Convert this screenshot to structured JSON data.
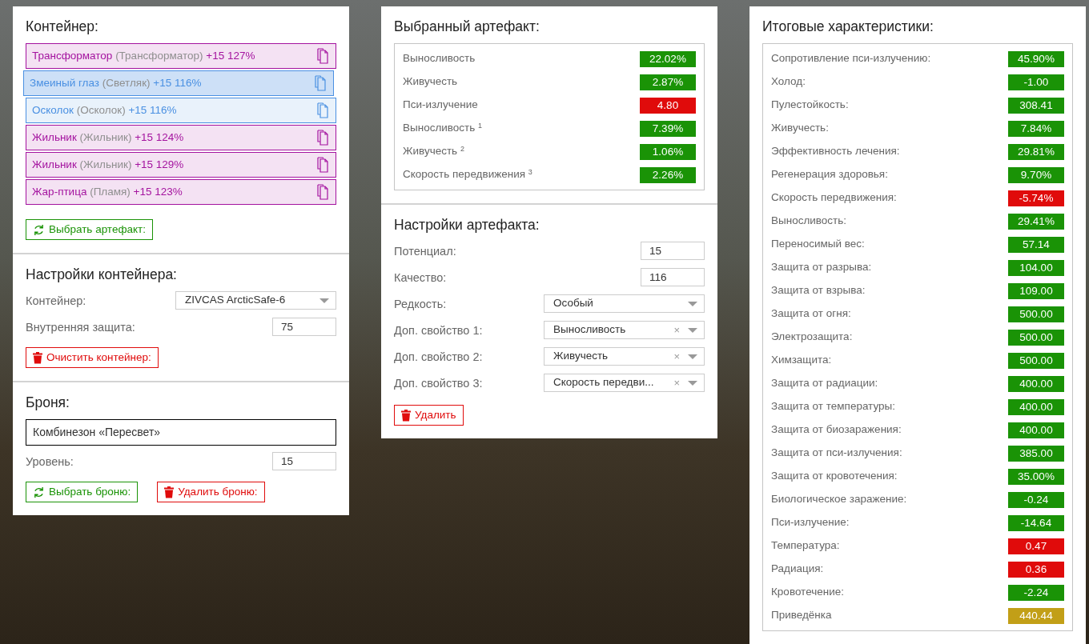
{
  "container": {
    "title": "Контейнер:",
    "artifacts": [
      {
        "name": "Трансформатор",
        "origin": "(Трансформатор)",
        "bonus": "+15 127%",
        "color": "#a4139f",
        "selected": false
      },
      {
        "name": "Змеиный глаз",
        "origin": "(Светляк)",
        "bonus": "+15 116%",
        "color": "#4a90e2",
        "selected": true
      },
      {
        "name": "Осколок",
        "origin": "(Осколок)",
        "bonus": "+15 116%",
        "color": "#4a90e2",
        "selected": false
      },
      {
        "name": "Жильник",
        "origin": "(Жильник)",
        "bonus": "+15 124%",
        "color": "#a4139f",
        "selected": false
      },
      {
        "name": "Жильник",
        "origin": "(Жильник)",
        "bonus": "+15 129%",
        "color": "#a4139f",
        "selected": false
      },
      {
        "name": "Жар-птица",
        "origin": "(Пламя)",
        "bonus": "+15 123%",
        "color": "#a4139f",
        "selected": false
      }
    ],
    "buttons": [
      {
        "kind": "select",
        "label": "Выбрать артефакт:"
      }
    ]
  },
  "container_settings": {
    "title": "Настройки контейнера:",
    "fields": [
      {
        "kind": "select",
        "label": "Контейнер:",
        "value": "ZIVCAS ArcticSafe-6"
      },
      {
        "kind": "input",
        "label": "Внутренняя защита:",
        "value": "75"
      }
    ],
    "buttons": [
      {
        "kind": "delete",
        "label": "Очистить контейнер:"
      }
    ]
  },
  "armor": {
    "title": "Броня:",
    "name": "Комбинезон «Пересвет»",
    "fields": [
      {
        "kind": "input",
        "label": "Уровень:",
        "value": "15"
      }
    ],
    "buttons": [
      {
        "kind": "select",
        "label": "Выбрать броню:"
      },
      {
        "kind": "delete",
        "label": "Удалить броню:"
      }
    ]
  },
  "selected_artifact": {
    "title": "Выбранный артефакт:",
    "stats": [
      {
        "name": "Выносливость",
        "value": "22.02%",
        "color": "#1a9306"
      },
      {
        "name": "Живучесть",
        "value": "2.87%",
        "color": "#1a9306"
      },
      {
        "name": "Пси-излучение",
        "value": "4.80",
        "color": "#e00b0b"
      },
      {
        "name": "Выносливость $^{1}$",
        "value": "7.39%",
        "color": "#1a9306"
      },
      {
        "name": "Живучесть $^{2}$",
        "value": "1.06%",
        "color": "#1a9306"
      },
      {
        "name": "Скорость передвижения $^{3}$",
        "value": "2.26%",
        "color": "#1a9306"
      }
    ]
  },
  "artifact_settings": {
    "title": "Настройки артефакта:",
    "fields": [
      {
        "kind": "input",
        "label": "Потенциал:",
        "value": "15"
      },
      {
        "kind": "input",
        "label": "Качество:",
        "value": "116"
      },
      {
        "kind": "select",
        "label": "Редкость:",
        "value": "Особый"
      },
      {
        "kind": "select",
        "label": "Доп. свойство 1:",
        "value": "Выносливость",
        "clear": "×"
      },
      {
        "kind": "select",
        "label": "Доп. свойство 2:",
        "value": "Живучесть",
        "clear": "×"
      },
      {
        "kind": "select",
        "label": "Доп. свойство 3:",
        "value": "Скорость передви...",
        "clear": "×"
      }
    ],
    "buttons": [
      {
        "kind": "delete",
        "label": "Удалить"
      }
    ]
  },
  "totals": {
    "title": "Итоговые характеристики:",
    "stats": [
      {
        "name": "Сопротивление пси-излучению:",
        "value": "45.90%",
        "color": "#1a9306"
      },
      {
        "name": "Холод:",
        "value": "-1.00",
        "color": "#1a9306"
      },
      {
        "name": "Пулестойкость:",
        "value": "308.41",
        "color": "#1a9306"
      },
      {
        "name": "Живучесть:",
        "value": "7.84%",
        "color": "#1a9306"
      },
      {
        "name": "Эффективность лечения:",
        "value": "29.81%",
        "color": "#1a9306"
      },
      {
        "name": "Регенерация здоровья:",
        "value": "9.70%",
        "color": "#1a9306"
      },
      {
        "name": "Скорость передвижения:",
        "value": "-5.74%",
        "color": "#e00b0b"
      },
      {
        "name": "Выносливость:",
        "value": "29.41%",
        "color": "#1a9306"
      },
      {
        "name": "Переносимый вес:",
        "value": "57.14",
        "color": "#1a9306"
      },
      {
        "name": "Защита от разрыва:",
        "value": "104.00",
        "color": "#1a9306"
      },
      {
        "name": "Защита от взрыва:",
        "value": "109.00",
        "color": "#1a9306"
      },
      {
        "name": "Защита от огня:",
        "value": "500.00",
        "color": "#1a9306"
      },
      {
        "name": "Электрозащита:",
        "value": "500.00",
        "color": "#1a9306"
      },
      {
        "name": "Химзащита:",
        "value": "500.00",
        "color": "#1a9306"
      },
      {
        "name": "Защита от радиации:",
        "value": "400.00",
        "color": "#1a9306"
      },
      {
        "name": "Защита от температуры:",
        "value": "400.00",
        "color": "#1a9306"
      },
      {
        "name": "Защита от биозаражения:",
        "value": "400.00",
        "color": "#1a9306"
      },
      {
        "name": "Защита от пси-излучения:",
        "value": "385.00",
        "color": "#1a9306"
      },
      {
        "name": "Защита от кровотечения:",
        "value": "35.00%",
        "color": "#1a9306"
      },
      {
        "name": "Биологическое заражение:",
        "value": "-0.24",
        "color": "#1a9306"
      },
      {
        "name": "Пси-излучение:",
        "value": "-14.64",
        "color": "#1a9306"
      },
      {
        "name": "Температура:",
        "value": "0.47",
        "color": "#e00b0b"
      },
      {
        "name": "Радиация:",
        "value": "0.36",
        "color": "#e00b0b"
      },
      {
        "name": "Кровотечение:",
        "value": "-2.24",
        "color": "#1a9306"
      },
      {
        "name": "Приведёнка",
        "value": "440.44",
        "color": "#c29f17"
      }
    ]
  }
}
